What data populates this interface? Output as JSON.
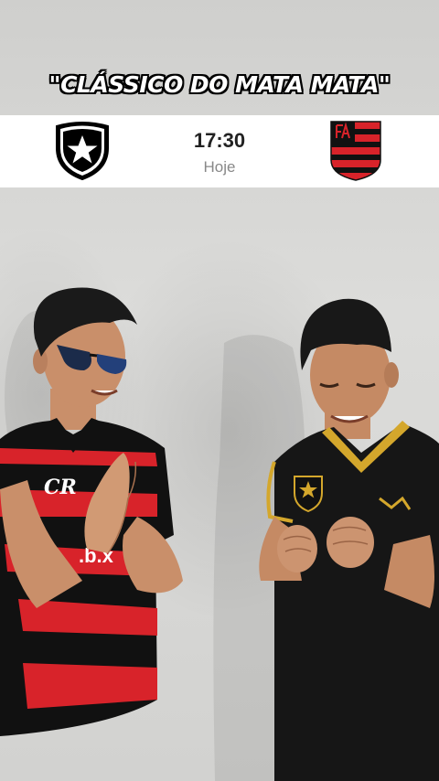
{
  "caption": "\"CLÁSSICO DO MATA MATA\"",
  "match": {
    "time": "17:30",
    "day": "Hoje",
    "home_crest": "botafogo-crest",
    "away_crest": "flamengo-crest"
  },
  "colors": {
    "wall": "#d9d9d7",
    "flamengo_red": "#d8232a",
    "flamengo_black": "#111111",
    "botafogo_black": "#161616",
    "gold": "#d4a72c"
  }
}
